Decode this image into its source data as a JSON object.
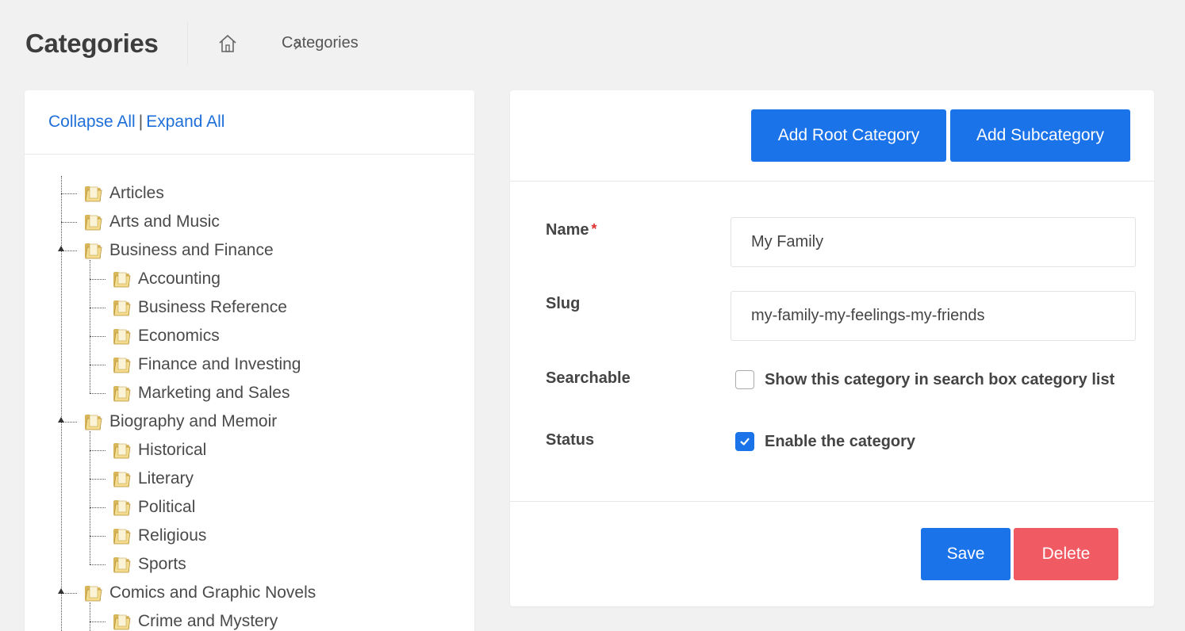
{
  "header": {
    "title": "Categories",
    "breadcrumb_current": "Categories"
  },
  "tree": {
    "collapse_all": "Collapse All",
    "separator": "|",
    "expand_all": "Expand All",
    "items": [
      {
        "label": "Articles",
        "level": 0
      },
      {
        "label": "Arts and Music",
        "level": 0
      },
      {
        "label": "Business and Finance",
        "level": 0,
        "expanded": true
      },
      {
        "label": "Accounting",
        "level": 1
      },
      {
        "label": "Business Reference",
        "level": 1
      },
      {
        "label": "Economics",
        "level": 1
      },
      {
        "label": "Finance and Investing",
        "level": 1
      },
      {
        "label": "Marketing and Sales",
        "level": 1
      },
      {
        "label": "Biography and Memoir",
        "level": 0,
        "expanded": true
      },
      {
        "label": "Historical",
        "level": 1
      },
      {
        "label": "Literary",
        "level": 1
      },
      {
        "label": "Political",
        "level": 1
      },
      {
        "label": "Religious",
        "level": 1
      },
      {
        "label": "Sports",
        "level": 1
      },
      {
        "label": "Comics and Graphic Novels",
        "level": 0,
        "expanded": true
      },
      {
        "label": "Crime and Mystery",
        "level": 1
      }
    ]
  },
  "form": {
    "add_root_label": "Add Root Category",
    "add_sub_label": "Add Subcategory",
    "name_label": "Name",
    "required_mark": "*",
    "name_value": "My Family",
    "slug_label": "Slug",
    "slug_value": "my-family-my-feelings-my-friends",
    "searchable_label": "Searchable",
    "searchable_text": "Show this category in search box category list",
    "searchable_checked": false,
    "status_label": "Status",
    "status_text": "Enable the category",
    "status_checked": true,
    "save_label": "Save",
    "delete_label": "Delete"
  },
  "colors": {
    "primary": "#1a73e8",
    "danger": "#f05a62",
    "link": "#1e6fd9",
    "background": "#f1f1f1"
  },
  "icons": {
    "home": "home-icon",
    "chevron": "chevron-right-icon",
    "folder": "folder-icon",
    "check": "check-icon"
  }
}
